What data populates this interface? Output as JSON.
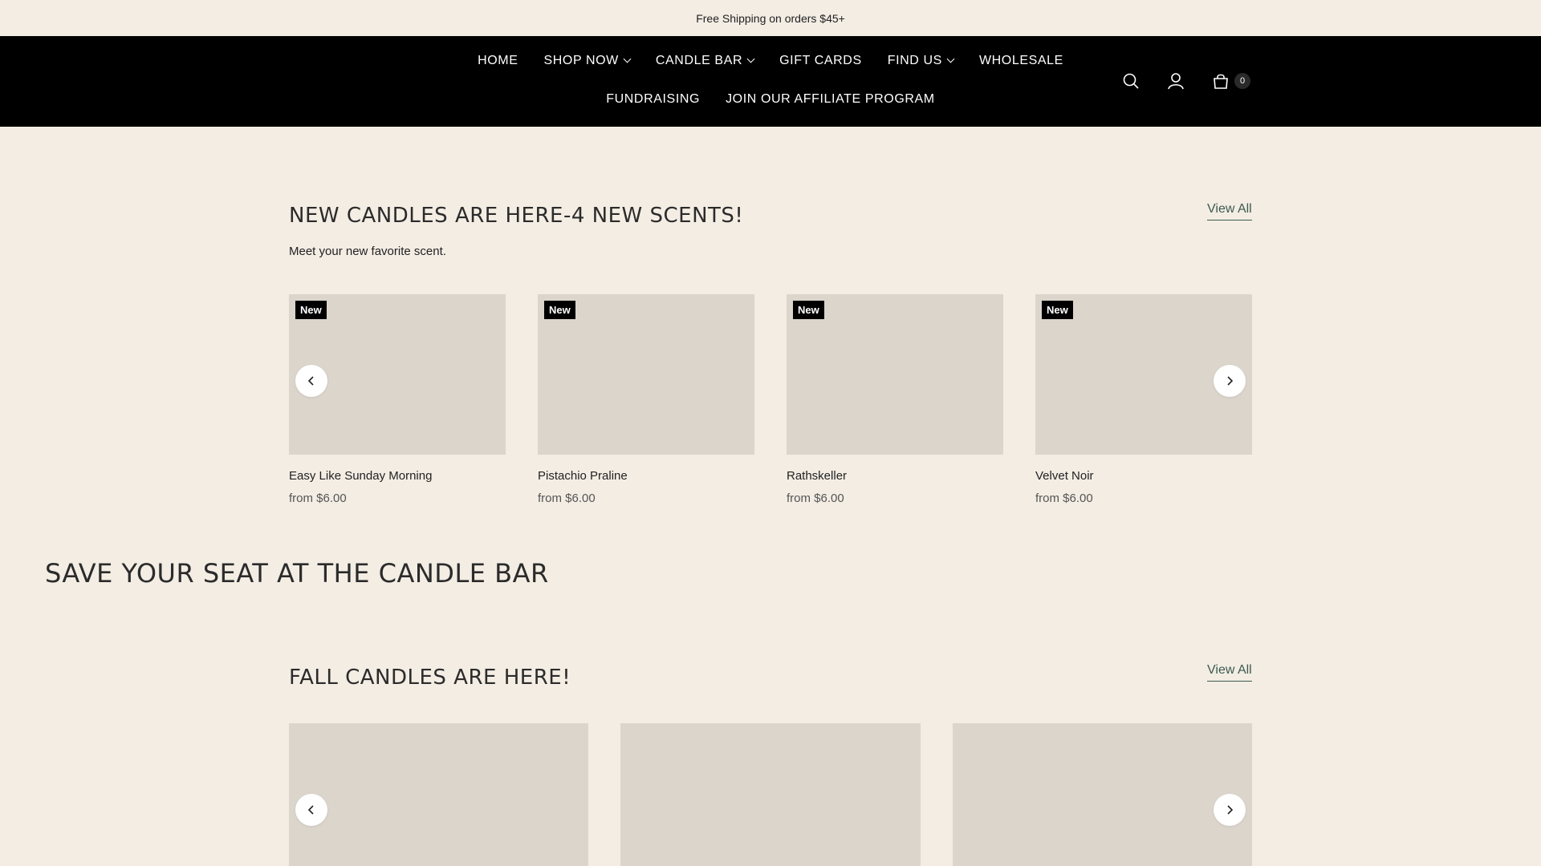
{
  "announcement": "Free Shipping on orders $45+",
  "nav": {
    "row1": [
      {
        "label": "HOME",
        "dropdown": false
      },
      {
        "label": "SHOP NOW",
        "dropdown": true
      },
      {
        "label": "CANDLE BAR",
        "dropdown": true
      },
      {
        "label": "GIFT CARDS",
        "dropdown": false
      },
      {
        "label": "FIND US",
        "dropdown": true
      },
      {
        "label": "WHOLESALE",
        "dropdown": false
      }
    ],
    "row2": [
      {
        "label": "FUNDRAISING",
        "dropdown": false
      },
      {
        "label": "JOIN OUR AFFILIATE PROGRAM",
        "dropdown": false
      }
    ]
  },
  "header_icons": {
    "search": "search-icon",
    "account": "user-icon",
    "cart": "bag-icon",
    "cart_count": "0"
  },
  "new_candles": {
    "title": "NEW CANDLES ARE HERE-4 NEW SCENTS!",
    "subtitle": "Meet your new favorite scent.",
    "view_all": "View All",
    "products": [
      {
        "badge": "New",
        "name": "Easy Like Sunday Morning",
        "price": "from $6.00"
      },
      {
        "badge": "New",
        "name": "Pistachio Praline",
        "price": "from $6.00"
      },
      {
        "badge": "New",
        "name": "Rathskeller",
        "price": "from $6.00"
      },
      {
        "badge": "New",
        "name": "Velvet Noir",
        "price": "from $6.00"
      }
    ]
  },
  "candle_bar": {
    "title": "SAVE YOUR SEAT AT THE CANDLE BAR"
  },
  "fall_candles": {
    "title": "FALL CANDLES ARE HERE!",
    "view_all": "View All",
    "products_visible": 3
  },
  "colors": {
    "background": "#f3ede4",
    "header": "#000000",
    "placeholder": "#dbd5cc",
    "link": "#3d5a50"
  }
}
